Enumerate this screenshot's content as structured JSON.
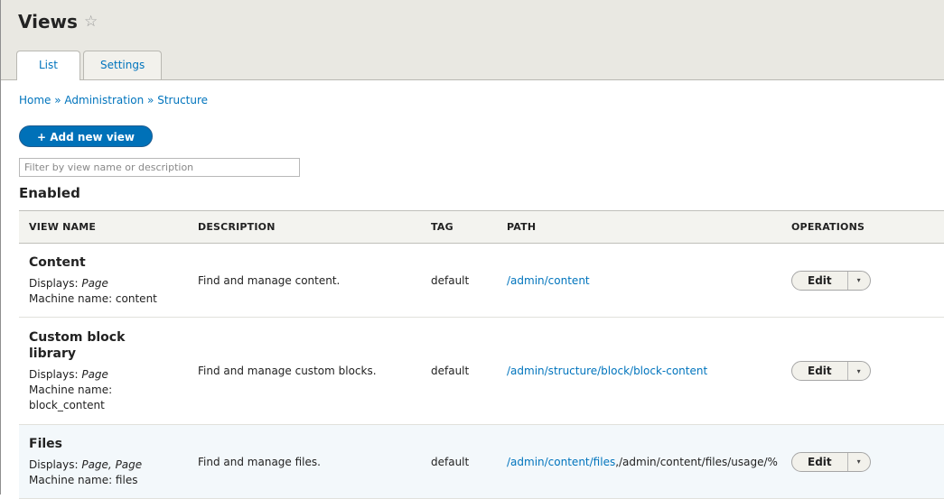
{
  "header": {
    "title": "Views",
    "star_icon": "☆"
  },
  "tabs": [
    {
      "label": "List"
    },
    {
      "label": "Settings"
    }
  ],
  "breadcrumb": {
    "home": "Home",
    "sep": " » ",
    "admin": "Administration",
    "structure": "Structure"
  },
  "add_button": {
    "label": "+ Add new view"
  },
  "filter": {
    "placeholder": "Filter by view name or description",
    "value": ""
  },
  "section": {
    "title": "Enabled"
  },
  "table": {
    "headers": {
      "name": "VIEW NAME",
      "description": "DESCRIPTION",
      "tag": "TAG",
      "path": "PATH",
      "operations": "OPERATIONS"
    },
    "rows": [
      {
        "name": "Content",
        "displays_label": "Displays: ",
        "displays": "Page",
        "machine": "Machine name: content",
        "description": "Find and manage content.",
        "tag": "default",
        "path_link": "/admin/content",
        "path_rest": "",
        "edit": "Edit",
        "dropdown": "▾"
      },
      {
        "name": "Custom block library",
        "displays_label": "Displays: ",
        "displays": "Page",
        "machine": "Machine name: block_content",
        "description": "Find and manage custom blocks.",
        "tag": "default",
        "path_link": "/admin/structure/block/block-content",
        "path_rest": "",
        "edit": "Edit",
        "dropdown": "▾"
      },
      {
        "name": "Files",
        "displays_label": "Displays: ",
        "displays": "Page, Page",
        "machine": "Machine name: files",
        "description": "Find and manage files.",
        "tag": "default",
        "path_link": "/admin/content/files",
        "path_rest": ",/admin/content/files/usage/%",
        "edit": "Edit",
        "dropdown": "▾"
      }
    ]
  }
}
